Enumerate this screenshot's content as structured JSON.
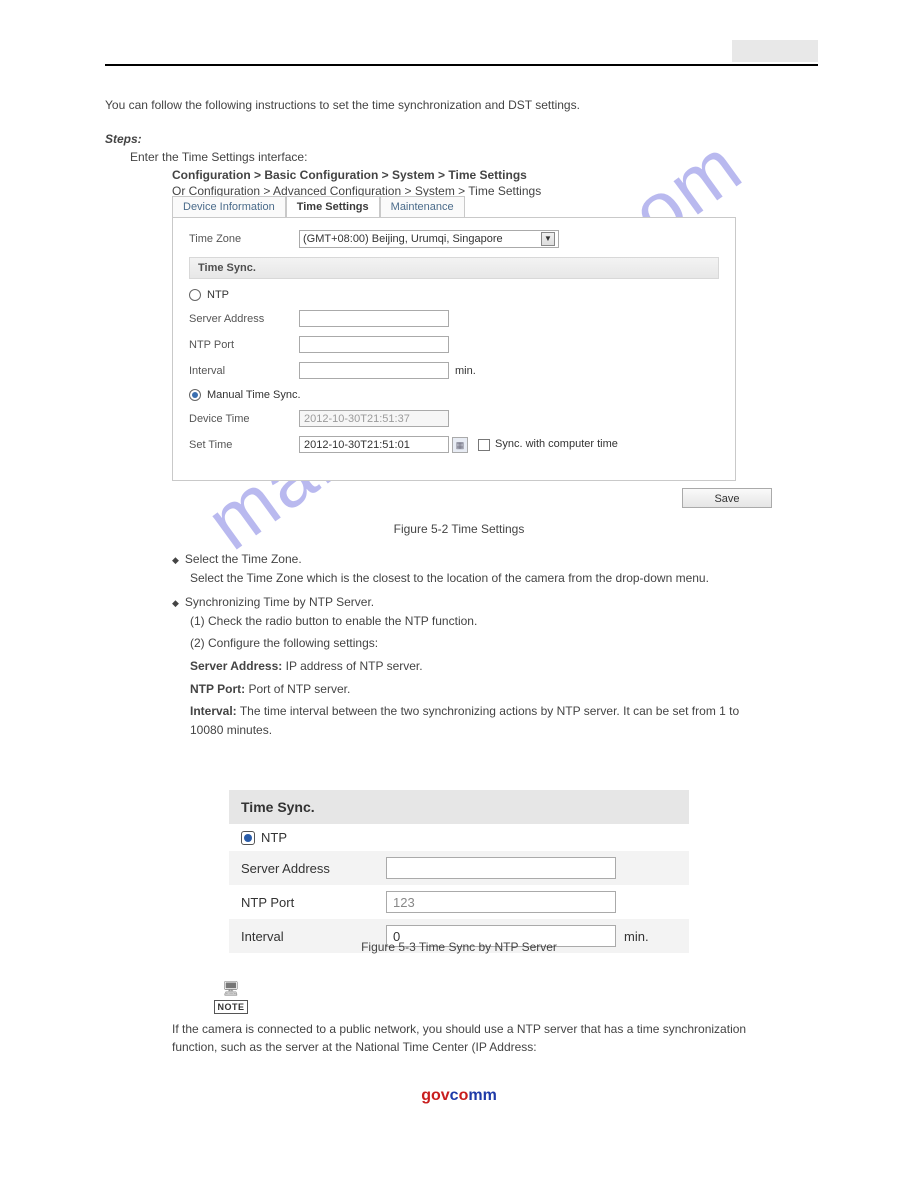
{
  "watermark": "manualshive.com",
  "header": {
    "product": "",
    "badge": ""
  },
  "intro": {
    "line1": "You can follow the following instructions to set the time synchronization and DST settings.",
    "steps_heading": "Steps:",
    "step1": "Enter the Time Settings interface:",
    "path": "Configuration > Basic Configuration > System > Time Settings",
    "or": "Or Configuration > Advanced Configuration > System > Time Settings"
  },
  "fig1": {
    "tabs": [
      "Device Information",
      "Time Settings",
      "Maintenance"
    ],
    "tz_label": "Time Zone",
    "tz_value": "(GMT+08:00) Beijing, Urumqi, Singapore",
    "section": "Time Sync.",
    "ntp_label": "NTP",
    "server_label": "Server Address",
    "port_label": "NTP Port",
    "interval_label": "Interval",
    "interval_unit": "min.",
    "manual_label": "Manual Time Sync.",
    "device_time_label": "Device Time",
    "device_time_value": "2012-10-30T21:51:37",
    "set_time_label": "Set Time",
    "set_time_value": "2012-10-30T21:51:01",
    "sync_label": "Sync. with computer time",
    "save": "Save",
    "caption": "Figure 5-2 Time Settings"
  },
  "bullets": {
    "b1": "Select the Time Zone.",
    "b1a": "Select the Time Zone which is the closest to the location of the camera from the drop-down menu.",
    "b2": "Synchronizing Time by NTP Server.",
    "b2a": "(1) Check the radio button to enable the NTP function.",
    "b2b": "(2) Configure the following settings:",
    "b2c_l": "Server Address:",
    "b2c_v": "IP address of NTP server.",
    "b2d_l": "NTP Port:",
    "b2d_v": "Port of NTP server.",
    "b2e_l": "Interval:",
    "b2e_v": "The time interval between the two synchronizing actions by NTP server. It can be set from 1 to 10080 minutes."
  },
  "fig2": {
    "head": "Time Sync.",
    "ntp": "NTP",
    "server_label": "Server Address",
    "port_label": "NTP Port",
    "port_value": "123",
    "interval_label": "Interval",
    "interval_value": "0",
    "interval_unit": "min.",
    "caption": "Figure 5-3 Time Sync by NTP Server"
  },
  "note": {
    "label": "NOTE",
    "text": "If the camera is connected to a public network, you should use a NTP server that has a time synchronization function, such as the server at the National Time Center (IP Address:"
  },
  "footer": {
    "brand_g": "gov",
    "brand_c": "c",
    "brand_o": "o",
    "brand_mm": "mm",
    "addr": ""
  }
}
